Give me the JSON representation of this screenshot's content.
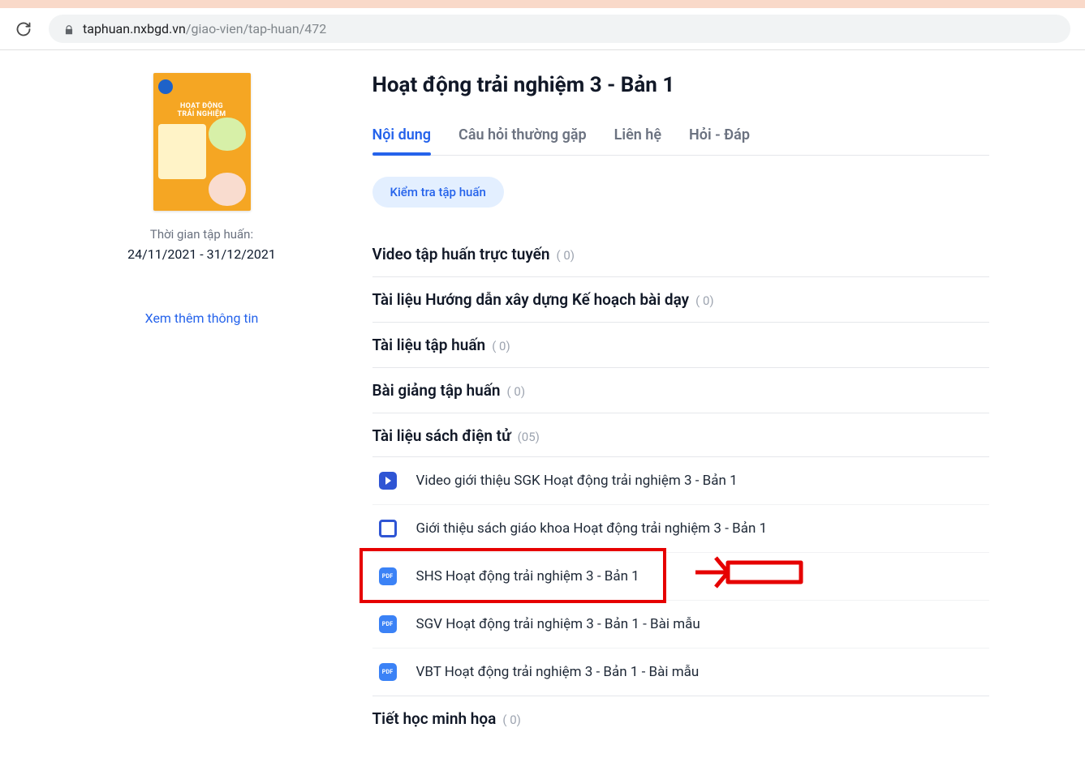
{
  "browser": {
    "domain": "taphuan.nxbgd.vn",
    "path": "/giao-vien/tap-huan/472"
  },
  "sidebar": {
    "book_title_line1": "HOẠT ĐỘNG",
    "book_title_line2": "TRẢI NGHIỆM",
    "time_label": "Thời gian tập huấn:",
    "time_value": "24/11/2021 - 31/12/2021",
    "more_link": "Xem thêm thông tin"
  },
  "main": {
    "title": "Hoạt động trải nghiệm 3 - Bản 1",
    "tabs": [
      {
        "label": "Nội dung",
        "active": true
      },
      {
        "label": "Câu hỏi thường gặp",
        "active": false
      },
      {
        "label": "Liên hệ",
        "active": false
      },
      {
        "label": "Hỏi - Đáp",
        "active": false
      }
    ],
    "test_button": "Kiểm tra tập huấn",
    "sections": [
      {
        "title": "Video tập huấn trực tuyến",
        "count": "( 0)"
      },
      {
        "title": "Tài liệu Hướng dẫn xây dựng Kế hoạch bài dạy",
        "count": "( 0)"
      },
      {
        "title": "Tài liệu tập huấn",
        "count": "( 0)"
      },
      {
        "title": "Bài giảng tập huấn",
        "count": "( 0)"
      }
    ],
    "ebook_section": {
      "title": "Tài liệu sách điện tử",
      "count": "(05)"
    },
    "resources": [
      {
        "icon": "play",
        "label": "Video giới thiệu SGK Hoạt động trải nghiệm 3 - Bản 1"
      },
      {
        "icon": "slide",
        "label": "Giới thiệu sách giáo khoa Hoạt động trải nghiệm 3 - Bản 1"
      },
      {
        "icon": "pdf",
        "label": "SHS Hoạt động trải nghiệm 3 - Bản 1",
        "highlight": true
      },
      {
        "icon": "pdf",
        "label": "SGV Hoạt động trải nghiệm 3 - Bản 1 - Bài mẫu"
      },
      {
        "icon": "pdf",
        "label": "VBT Hoạt động trải nghiệm 3 - Bản 1 - Bài mẫu"
      }
    ],
    "demo_section": {
      "title": "Tiết học minh họa",
      "count": "( 0)"
    }
  },
  "icon_text": {
    "pdf": "PDF"
  }
}
